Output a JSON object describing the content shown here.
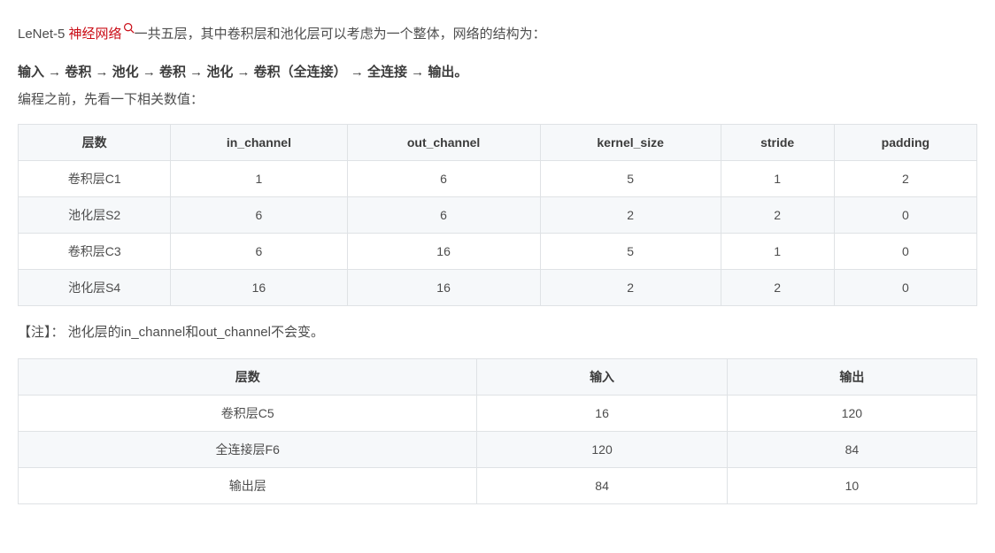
{
  "intro": {
    "prefix": "LeNet-5 ",
    "link_text": "神经网络",
    "suffix": "一共五层，其中卷积层和池化层可以考虑为一个整体，网络的结构为："
  },
  "bold_line": "输入 → 卷积 → 池化 → 卷积 → 池化 → 卷积（全连接） → 全连接 → 输出。",
  "pretext": "编程之前，先看一下相关数值：",
  "chart_data": [
    {
      "type": "table",
      "columns": [
        "层数",
        "in_channel",
        "out_channel",
        "kernel_size",
        "stride",
        "padding"
      ],
      "rows": [
        [
          "卷积层C1",
          "1",
          "6",
          "5",
          "1",
          "2"
        ],
        [
          "池化层S2",
          "6",
          "6",
          "2",
          "2",
          "0"
        ],
        [
          "卷积层C3",
          "6",
          "16",
          "5",
          "1",
          "0"
        ],
        [
          "池化层S4",
          "16",
          "16",
          "2",
          "2",
          "0"
        ]
      ]
    },
    {
      "type": "table",
      "columns": [
        "层数",
        "输入",
        "输出"
      ],
      "rows": [
        [
          "卷积层C5",
          "16",
          "120"
        ],
        [
          "全连接层F6",
          "120",
          "84"
        ],
        [
          "输出层",
          "84",
          "10"
        ]
      ]
    }
  ],
  "note": "【注】： 池化层的in_channel和out_channel不会变。"
}
